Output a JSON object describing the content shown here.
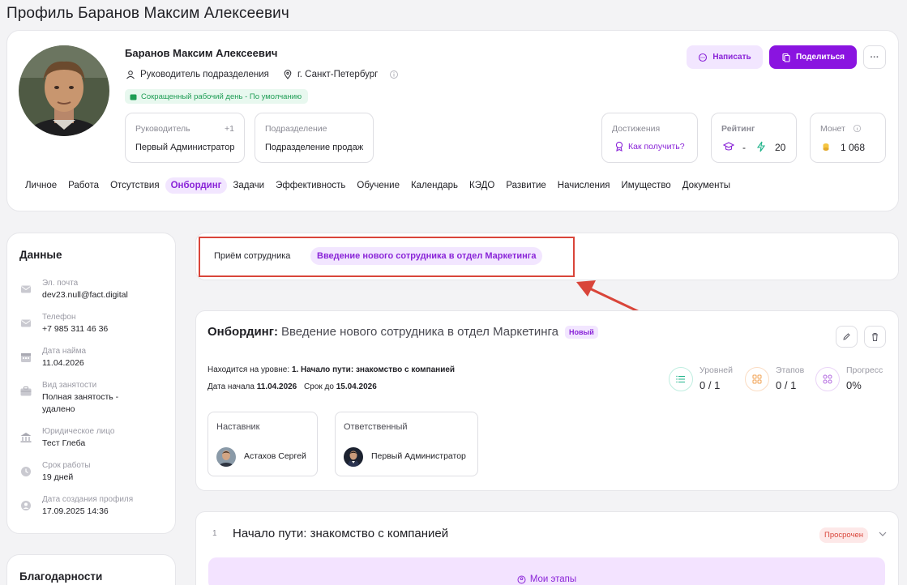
{
  "page": {
    "title": "Профиль Баранов Максим Алексеевич"
  },
  "profile": {
    "name": "Баранов Максим Алексеевич",
    "position": "Руководитель подразделения",
    "city": "г. Санкт-Петербург",
    "schedule": "Сокращенный рабочий день - По умолчанию",
    "write_label": "Написать",
    "share_label": "Поделиться",
    "more_label": "···",
    "manager": {
      "label": "Руководитель",
      "extra": "+1",
      "value": "Первый Администратор"
    },
    "department": {
      "label": "Подразделение",
      "value": "Подразделение продаж"
    },
    "achievements": {
      "label": "Достижения",
      "link": "Как получить?"
    },
    "rating": {
      "label": "Рейтинг",
      "value1": "-",
      "value2": "20"
    },
    "coins": {
      "label": "Монет",
      "value": "1 068"
    }
  },
  "tabs": [
    "Личное",
    "Работа",
    "Отсутствия",
    "Онбординг",
    "Задачи",
    "Эффективность",
    "Обучение",
    "Календарь",
    "КЭДО",
    "Развитие",
    "Начисления",
    "Имущество",
    "Документы"
  ],
  "active_tab": "Онбординг",
  "sidebar": {
    "title": "Данные",
    "fields": [
      {
        "label": "Эл. почта",
        "value": "dev23.null@fact.digital",
        "icon": "mail-icon"
      },
      {
        "label": "Телефон",
        "value": "+7 985 311 46 36",
        "icon": "phone-icon"
      },
      {
        "label": "Дата найма",
        "value": "11.04.2026",
        "icon": "calendar-icon"
      },
      {
        "label": "Вид занятости",
        "value": "Полная занятость -",
        "value2": "удалено",
        "icon": "briefcase-icon"
      },
      {
        "label": "Юридическое лицо",
        "value": "Тест Глеба",
        "icon": "bank-icon"
      },
      {
        "label": "Срок работы",
        "value": "19 дней",
        "icon": "clock-icon"
      },
      {
        "label": "Дата создания профиля",
        "value": "17.09.2025 14:36",
        "icon": "user-clock-icon"
      }
    ],
    "thanks_title": "Благодарности"
  },
  "onboarding_select": {
    "label": "Приём сотрудника",
    "chip": "Введение нового сотрудника в отдел Маркетинга"
  },
  "onboarding": {
    "title_prefix": "Онбординг:",
    "title": "Введение нового сотрудника в отдел Маркетинга",
    "status": "Новый",
    "level_label": "Находится на уровне:",
    "level_value": "1. Начало пути: знакомство с компанией",
    "start_label": "Дата начала",
    "start_value": "11.04.2026",
    "due_label": "Срок до",
    "due_value": "15.04.2026",
    "stats": [
      {
        "label": "Уровней",
        "value": "0 / 1",
        "color": "#1fb38a"
      },
      {
        "label": "Этапов",
        "value": "0 / 1",
        "color": "#f0a050"
      },
      {
        "label": "Прогресс",
        "value": "0%",
        "color": "#b36ae0"
      }
    ],
    "mentor": {
      "label": "Наставник",
      "name": "Астахов Сергей"
    },
    "responsible": {
      "label": "Ответственный",
      "name": "Первый Администратор"
    }
  },
  "stage": {
    "number": "1",
    "title": "Начало пути: знакомство с компанией",
    "status": "Просрочен",
    "my_stages": "Мои этапы"
  },
  "colors": {
    "accent": "#8a24d8",
    "highlight": "#d9453a"
  }
}
